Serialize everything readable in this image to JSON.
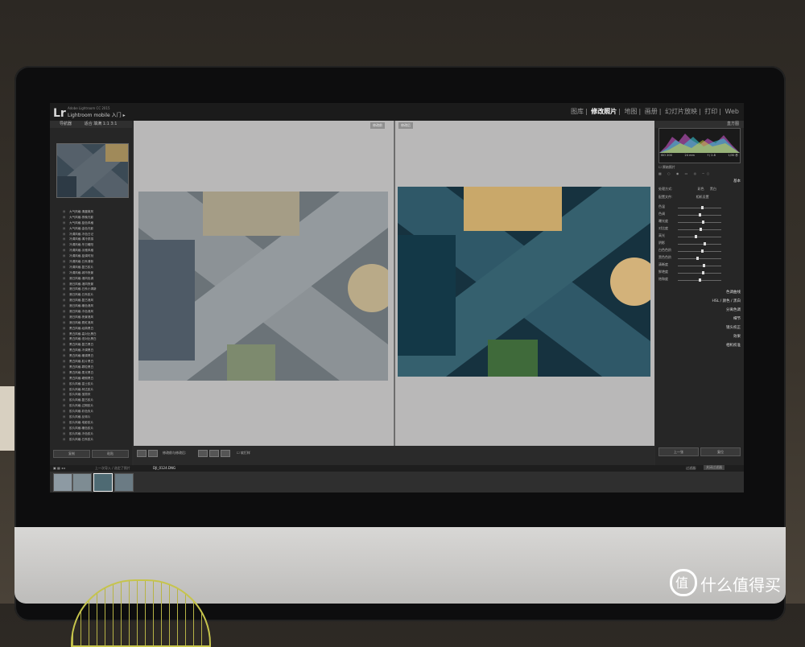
{
  "app": {
    "logo": "Lr",
    "sub_title": "Adobe Lightroom CC 2015",
    "identity": "Lightroom mobile 入门"
  },
  "modules": [
    "图库",
    "修改照片",
    "地图",
    "画册",
    "幻灯片放映",
    "打印",
    "Web"
  ],
  "active_module": "修改照片",
  "left_panel": {
    "navigator_title": "导航器",
    "navigator_zoom": "适合  填满  1:1  3:1",
    "presets": [
      "大气风格-清晨微风",
      "大气风格-夜晚光影",
      "大气风格-蓝色风格",
      "大气风格-金色光影",
      "冷调风格-冷色日记",
      "冷调风格-清冷质感",
      "冷调风格-冬日暖阳",
      "冷调风格-淡雅风格",
      "冷调风格-蓝调时刻",
      "冷调风格-日系清新",
      "冷调风格-复古胶片",
      "冷调风格-城市夜景",
      "港日风格-港风色调",
      "港日风格-港风夜景",
      "港日风格-日系小清新",
      "港日风格-日系胶片",
      "港日风格-复古港风",
      "港日风格-暖色港风",
      "港日风格-冷色港风",
      "港日风格-夜景港风",
      "港日风格-霓虹港风",
      "黑白风格-经典黑白",
      "黑白风格-高对比黑白",
      "黑白风格-低对比黑白",
      "黑白风格-复古黑白",
      "黑白风格-冷调黑白",
      "黑白风格-暖调黑白",
      "黑白风格-胶片黑白",
      "黑白风格-颗粒黑白",
      "黑白风格-柔光黑白",
      "黑白风格-硬朗黑白",
      "胶片风格-富士胶片",
      "胶片风格-柯达胶片",
      "胶片风格-宝丽来",
      "胶片风格-复古胶片",
      "胶片风格-过期胶片",
      "胶片风格-彩色负片",
      "胶片风格-反转片",
      "胶片风格-电影胶片",
      "胶片风格-暖色胶片",
      "胶片风格-冷色胶片",
      "胶片风格-日系胶片"
    ],
    "copy_button": "复制",
    "paste_button": "粘贴"
  },
  "center": {
    "before_label": "修改前",
    "after_label": "修改后"
  },
  "toolbar": {
    "view_label": "修改前与修改后:",
    "soft_proof": "软打样"
  },
  "right_panel": {
    "histogram_title": "直方图",
    "histogram_values": [
      "ISO 200",
      "24 mm",
      "f / 2.8",
      "1/30 秒"
    ],
    "original_photo": "原始照片",
    "basic_title": "基本",
    "treatment_label": "处理方式:",
    "treatment_options": [
      "彩色",
      "黑白"
    ],
    "profile_label": "配置文件:",
    "profile_value": "相机设置",
    "sliders": [
      {
        "label": "色温",
        "value": 0.55
      },
      {
        "label": "色调",
        "value": 0.5
      },
      {
        "label": "曝光度",
        "value": 0.58
      },
      {
        "label": "对比度",
        "value": 0.52
      },
      {
        "label": "高光",
        "value": 0.4
      },
      {
        "label": "阴影",
        "value": 0.62
      },
      {
        "label": "白色色阶",
        "value": 0.55
      },
      {
        "label": "黑色色阶",
        "value": 0.45
      },
      {
        "label": "清晰度",
        "value": 0.6
      },
      {
        "label": "鲜艳度",
        "value": 0.58
      },
      {
        "label": "饱和度",
        "value": 0.5
      }
    ],
    "sections": [
      "色调曲线",
      "HSL / 颜色 / 黑白",
      "分离色调",
      "细节",
      "镜头校正",
      "效果",
      "相机校准"
    ],
    "prev_button": "上一张",
    "reset_button": "复位"
  },
  "filmstrip": {
    "path": "上一次导入 / 选定了照片",
    "filename": "DJI_0124.DNG",
    "filter_label": "过滤器:",
    "filter_value": "关闭过滤器"
  },
  "watermark": {
    "glyph": "值",
    "text": "什么值得买"
  }
}
